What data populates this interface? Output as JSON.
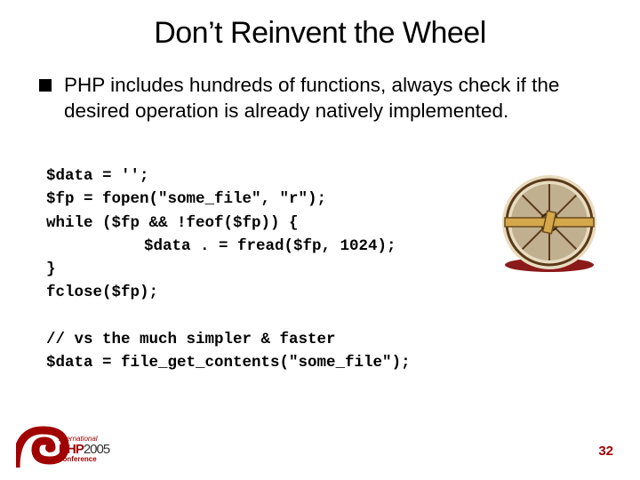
{
  "title": "Don’t Reinvent the Wheel",
  "bullet1": "PHP includes hundreds of functions, always check if the desired operation is already natively implemented.",
  "code": {
    "l1": "$data = '';",
    "l2": "$fp = fopen(\"some_file\", \"r\");",
    "l3": "while ($fp && !feof($fp)) {",
    "l4": "$data . = fread($fp, 1024);",
    "l5": "}",
    "l6": "fclose($fp);",
    "l7": "",
    "l8": "// vs the much simpler & faster",
    "l9": "$data = file_get_contents(\"some_file\");"
  },
  "page_number": "32",
  "logo": {
    "intl": "international",
    "php": "PHP",
    "year": "2005",
    "conf": "conference"
  },
  "icons": {
    "wheel": "wheel-illustration",
    "logo_swoosh": "php-conference-swoosh"
  }
}
